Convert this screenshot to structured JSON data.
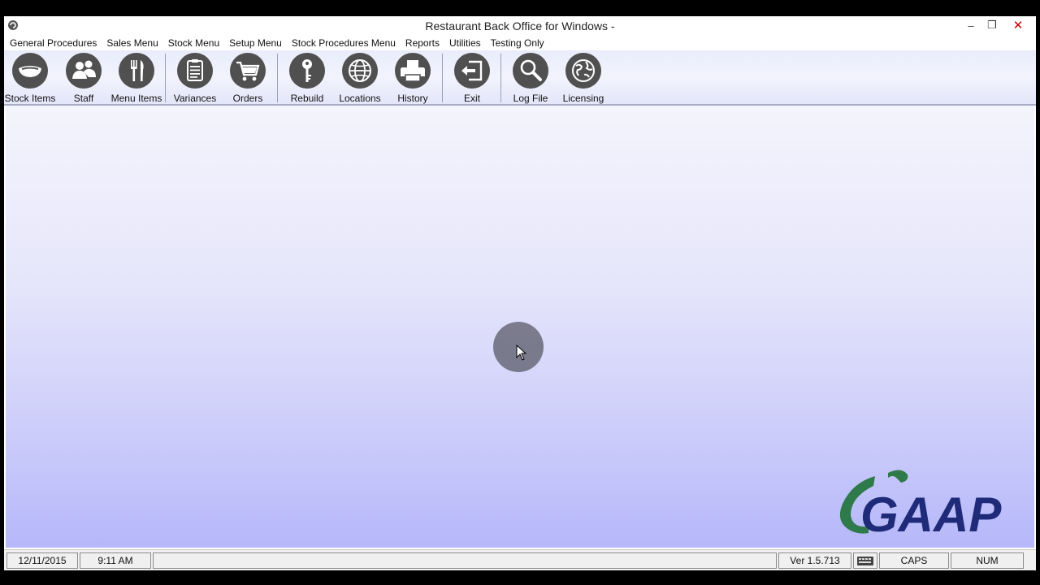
{
  "window": {
    "title": "Restaurant Back Office for Windows -",
    "controls": {
      "minimize": "–",
      "maximize": "❐",
      "close": "✕"
    }
  },
  "menu": [
    "General Procedures",
    "Sales Menu",
    "Stock Menu",
    "Setup Menu",
    "Stock Procedures Menu",
    "Reports",
    "Utilities",
    "Testing Only"
  ],
  "toolbar": [
    {
      "label": "Stock Items",
      "icon": "dish-icon"
    },
    {
      "label": "Staff",
      "icon": "people-icon"
    },
    {
      "label": "Menu Items",
      "icon": "cutlery-icon"
    },
    {
      "label": "Variances",
      "icon": "clipboard-icon"
    },
    {
      "label": "Orders",
      "icon": "cart-icon"
    },
    {
      "label": "Rebuild",
      "icon": "key-icon"
    },
    {
      "label": "Locations",
      "icon": "globe-icon"
    },
    {
      "label": "History",
      "icon": "printer-icon"
    },
    {
      "label": "Exit",
      "icon": "exit-icon"
    },
    {
      "label": "Log File",
      "icon": "magnifier-icon"
    },
    {
      "label": "Licensing",
      "icon": "world-icon"
    }
  ],
  "logo": {
    "text": "GAAP"
  },
  "status": {
    "date": "12/11/2015",
    "time": "9:11 AM",
    "message": "",
    "version": "Ver 1.5.713",
    "caps": "CAPS",
    "num": "NUM"
  },
  "colors": {
    "icon_circle": "#505050",
    "logo_blue": "#1f2a78",
    "logo_green": "#2f7a4a",
    "client_bottom": "#b5b7fa"
  }
}
